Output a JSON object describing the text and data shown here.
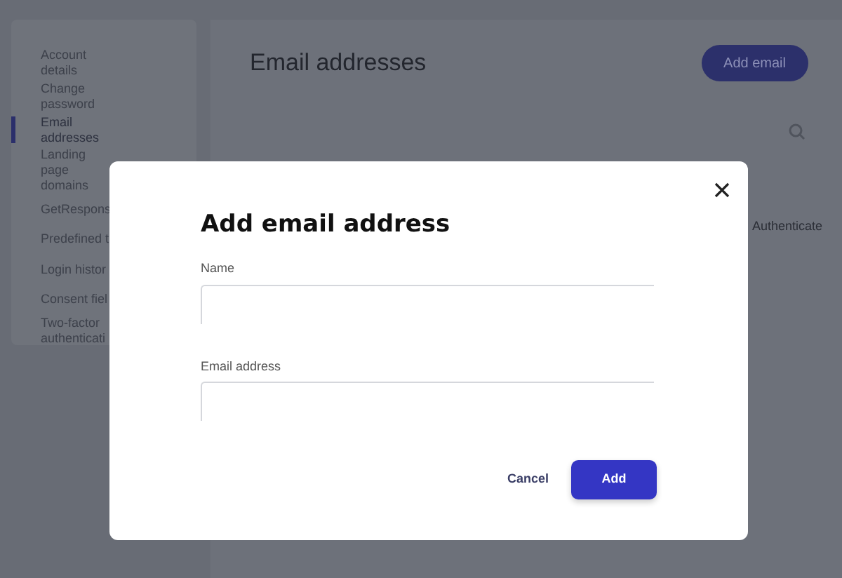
{
  "sidebar": {
    "items": [
      {
        "label": "Account details",
        "selected": false
      },
      {
        "label": "Change password",
        "selected": false
      },
      {
        "label": "Email addresses",
        "selected": true
      },
      {
        "label": "Landing page domains",
        "selected": false
      },
      {
        "label": "GetRespons",
        "selected": false
      },
      {
        "label": "Predefined t",
        "selected": false
      },
      {
        "label": "Login histor",
        "selected": false
      },
      {
        "label": "Consent fiel",
        "selected": false
      },
      {
        "label": "Two-factor authenticati",
        "selected": false
      }
    ]
  },
  "page": {
    "title": "Email addresses",
    "add_button": "Add email",
    "column_header": "Authenticate"
  },
  "dialog": {
    "title": "Add email address",
    "fields": [
      {
        "label": "Name"
      },
      {
        "label": "Email address"
      }
    ],
    "cancel": "Cancel",
    "submit": "Add"
  }
}
